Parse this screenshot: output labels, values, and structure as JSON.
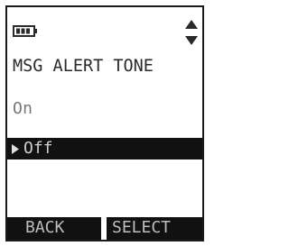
{
  "screen": {
    "title": "MSG ALERT TONE",
    "options": [
      "On",
      "Off"
    ],
    "selected_index": 1,
    "icons": {
      "battery": "battery-icon",
      "scroll": "up-down-arrow-icon",
      "selection": "selection-arrow-icon"
    }
  },
  "softkeys": {
    "left": "BACK",
    "right": "SELECT"
  }
}
